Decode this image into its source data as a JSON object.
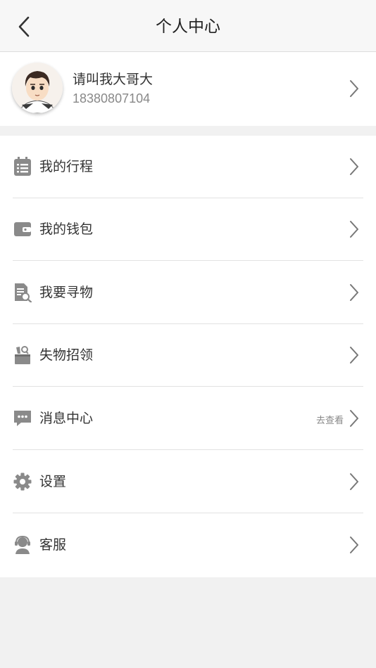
{
  "header": {
    "title": "个人中心"
  },
  "profile": {
    "name": "请叫我大哥大",
    "phone": "18380807104"
  },
  "menu": {
    "items": [
      {
        "label": "我的行程",
        "icon": "calendar-list-icon"
      },
      {
        "label": "我的钱包",
        "icon": "wallet-icon"
      },
      {
        "label": "我要寻物",
        "icon": "document-search-icon"
      },
      {
        "label": "失物招领",
        "icon": "lost-found-box-icon"
      },
      {
        "label": "消息中心",
        "icon": "chat-bubble-icon",
        "hint": "去查看"
      },
      {
        "label": "设置",
        "icon": "gear-icon"
      },
      {
        "label": "客服",
        "icon": "headset-agent-icon"
      }
    ]
  },
  "colors": {
    "icon": "#8a8a8a",
    "divider": "#e2e2e2",
    "page_bg": "#f1f1f1"
  }
}
